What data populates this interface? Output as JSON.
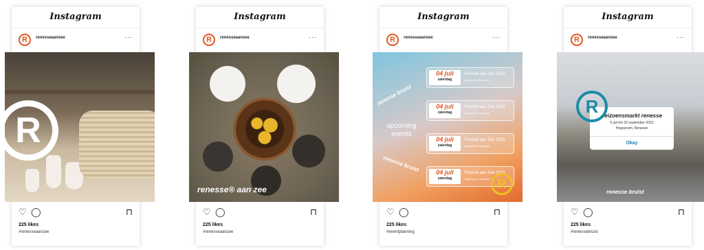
{
  "posts": [
    {
      "app_title": "Instagram",
      "username": "renesseaanzee",
      "avatar_letter": "R",
      "more": "···",
      "likes": "225 likes",
      "hashtag": "#renesseaanzee",
      "icons": [
        "heart-icon",
        "comment-icon",
        "bookmark-icon"
      ]
    },
    {
      "app_title": "Instagram",
      "username": "renesseaanzee",
      "avatar_letter": "R",
      "more": "···",
      "likes": "225 likes",
      "hashtag": "#renesseaanzee",
      "image_watermark": "renesse® aan zee",
      "icons": [
        "heart-icon",
        "comment-icon",
        "bookmark-icon"
      ]
    },
    {
      "app_title": "Instagram",
      "username": "renesseaanzee",
      "avatar_letter": "R",
      "more": "···",
      "likes": "225 likes",
      "hashtag": "#eventplanning",
      "upcoming": "upcoming events",
      "arc_top": "renesse bruist",
      "arc_bottom": "renesse bruist",
      "events": [
        {
          "date": "04 juli",
          "day": "zaterdag",
          "title": "Festival aan Zee 2023",
          "location": "Hogezoom, Renesse"
        },
        {
          "date": "04 juli",
          "day": "zaterdag",
          "title": "Festival aan Zee 2023",
          "location": "Hogezoom, Renesse"
        },
        {
          "date": "04 juli",
          "day": "zaterdag",
          "title": "Festival aan Zee 2023",
          "location": "Hogezoom, Renesse"
        },
        {
          "date": "04 juli",
          "day": "zaterdag",
          "title": "Festival aan Zee 2023",
          "location": "Hogezoom, Renesse"
        }
      ],
      "icons": [
        "heart-icon",
        "comment-icon",
        "bookmark-icon"
      ]
    },
    {
      "app_title": "Instagram",
      "username": "renesseaanzee",
      "avatar_letter": "R",
      "more": "···",
      "likes": "225 likes",
      "hashtag": "#renessebruist",
      "card_title": "seizoensmarkt renesse",
      "card_dates": "5 juli t/m 20 september 2023",
      "card_location": "Hogezoom, Renesse",
      "card_button": "Okay",
      "image_watermark": "renesse bruist",
      "icons": [
        "heart-icon",
        "comment-icon",
        "bookmark-icon"
      ]
    }
  ],
  "colors": {
    "brand_orange": "#e0561e",
    "brand_teal": "#1e8aa6",
    "link_blue": "#1e7fb5"
  }
}
